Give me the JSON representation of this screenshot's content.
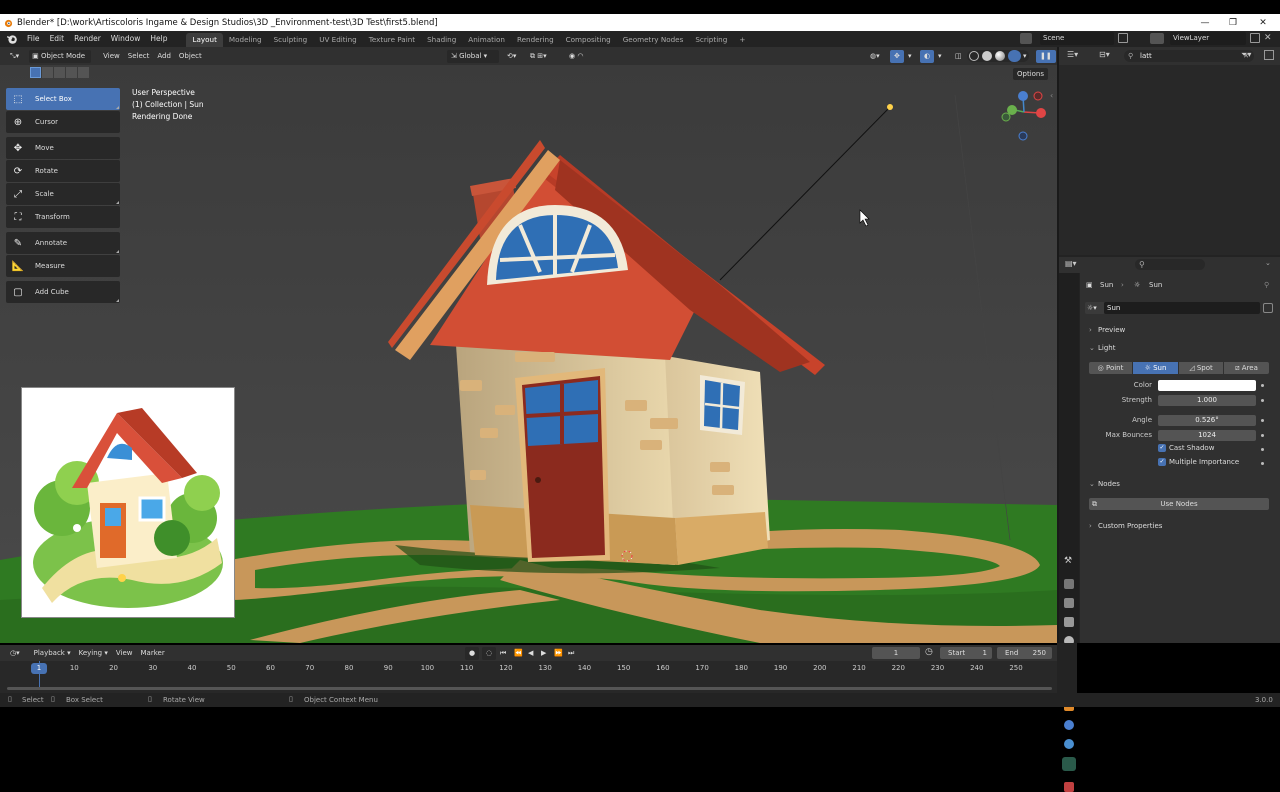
{
  "window": {
    "title": "Blender* [D:\\work\\Artiscoloris Ingame & Design Studios\\3D _Environment-test\\3D Test\\first5.blend]",
    "minimize": "—",
    "restore": "❐",
    "close": "✕"
  },
  "menu": [
    "File",
    "Edit",
    "Render",
    "Window",
    "Help"
  ],
  "workspaces": [
    "Layout",
    "Modeling",
    "Sculpting",
    "UV Editing",
    "Texture Paint",
    "Shading",
    "Animation",
    "Rendering",
    "Compositing",
    "Geometry Nodes",
    "Scripting"
  ],
  "workspace_add": "+",
  "scene": {
    "label": "Scene",
    "view_layer": "ViewLayer"
  },
  "viewport_header": {
    "mode": "Object Mode",
    "menus": [
      "View",
      "Select",
      "Add",
      "Object"
    ],
    "transform_orientation": "Global",
    "options": "Options"
  },
  "viewport_info": {
    "line1": "User Perspective",
    "line2": "(1) Collection | Sun",
    "line3": "Rendering Done"
  },
  "tools": [
    {
      "label": "Select Box",
      "icon": "select-box-icon",
      "active": true
    },
    {
      "label": "Cursor",
      "icon": "cursor-icon",
      "active": false
    },
    {
      "label": "Move",
      "icon": "move-icon",
      "active": false
    },
    {
      "label": "Rotate",
      "icon": "rotate-icon",
      "active": false
    },
    {
      "label": "Scale",
      "icon": "scale-icon",
      "active": false
    },
    {
      "label": "Transform",
      "icon": "transform-icon",
      "active": false
    },
    {
      "label": "Annotate",
      "icon": "annotate-icon",
      "active": false
    },
    {
      "label": "Measure",
      "icon": "measure-icon",
      "active": false
    },
    {
      "label": "Add Cube",
      "icon": "add-cube-icon",
      "active": false
    }
  ],
  "outliner": {
    "search_value": "latt"
  },
  "properties": {
    "breadcrumb_object": "Sun",
    "breadcrumb_data": "Sun",
    "datablock": "Sun",
    "preview_panel": "Preview",
    "light_panel": "Light",
    "light_types": [
      "Point",
      "Sun",
      "Spot",
      "Area"
    ],
    "light_type_active": "Sun",
    "color_label": "Color",
    "color_value": "#ffffff",
    "strength_label": "Strength",
    "strength": "1.000",
    "angle_label": "Angle",
    "angle": "0.526°",
    "max_bounces_label": "Max Bounces",
    "max_bounces": "1024",
    "cast_shadow": "Cast Shadow",
    "multiple_importance": "Multiple Importance",
    "nodes_panel": "Nodes",
    "use_nodes": "Use Nodes",
    "custom_props": "Custom Properties"
  },
  "timeline": {
    "menus": [
      "Playback",
      "Keying",
      "View",
      "Marker"
    ],
    "current_frame": "1",
    "start_label": "Start",
    "start": "1",
    "end_label": "End",
    "end": "250",
    "ticks": [
      "10",
      "20",
      "30",
      "40",
      "50",
      "60",
      "70",
      "80",
      "90",
      "100",
      "110",
      "120",
      "130",
      "140",
      "150",
      "160",
      "170",
      "180",
      "190",
      "200",
      "210",
      "220",
      "230",
      "240",
      "250"
    ]
  },
  "status": {
    "select": "Select",
    "box_select": "Box Select",
    "rotate_view": "Rotate View",
    "context_menu": "Object Context Menu",
    "version": "3.0.0"
  },
  "colors": {
    "accent": "#4772b3",
    "roof": "#c9452e",
    "wall": "#e8d4a8",
    "grass": "#2f7d24",
    "path": "#c89a5a",
    "door": "#8b2a1e",
    "window_blue": "#2f6fb5"
  }
}
